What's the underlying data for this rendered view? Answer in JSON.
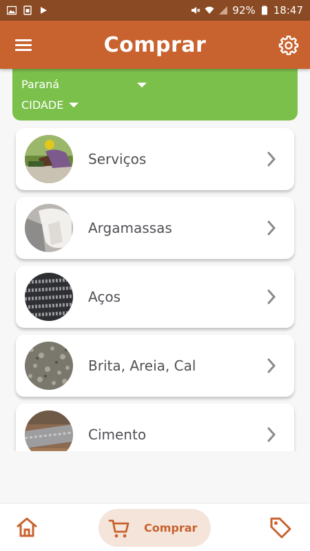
{
  "status_bar": {
    "battery": "92%",
    "time": "18:47"
  },
  "app_bar": {
    "title": "Comprar"
  },
  "filter": {
    "state": "Paraná",
    "city": "CIDADE"
  },
  "categories": [
    {
      "label": "Serviços",
      "image": "worker-photo"
    },
    {
      "label": "Argamassas",
      "image": "mortar-bag-photo"
    },
    {
      "label": "Aços",
      "image": "rebar-photo"
    },
    {
      "label": "Brita, Areia, Cal",
      "image": "gravel-photo"
    },
    {
      "label": "Cimento",
      "image": "cement-photo"
    }
  ],
  "bottom_nav": {
    "active_label": "Comprar"
  },
  "colors": {
    "primary": "#c8622e",
    "status_bar": "#8a4a23",
    "filter_bg": "#7cc04c",
    "pill_bg": "#f4e4da"
  },
  "icons": [
    "menu-icon",
    "settings-gear-icon",
    "chevron-right-icon",
    "home-icon",
    "cart-icon",
    "tag-icon"
  ]
}
